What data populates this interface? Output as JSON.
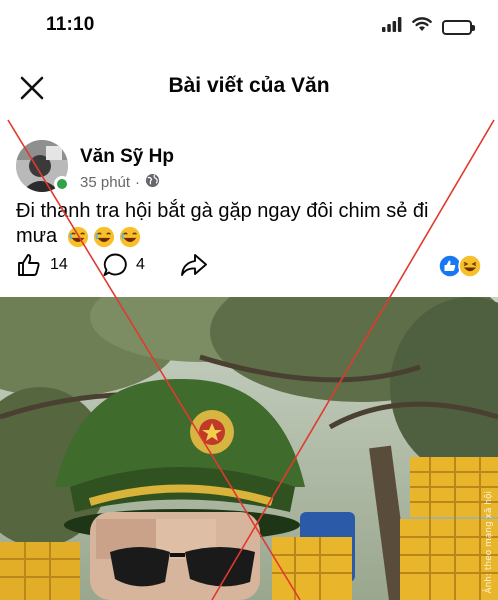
{
  "status_bar": {
    "time": "11:10",
    "icons": [
      "signal-icon",
      "wifi-icon",
      "battery-icon"
    ]
  },
  "nav": {
    "title": "Bài viết của Văn",
    "close_icon": "close-icon"
  },
  "post": {
    "author": "Văn Sỹ Hp",
    "time_ago": "35 phút",
    "separator": "·",
    "privacy_icon": "globe-icon",
    "text": "Đi thanh tra hội bắt gà gặp ngay đôi chim sẻ đi mưa",
    "emojis": [
      "laughing-emoji",
      "laughing-emoji",
      "laughing-emoji"
    ],
    "likes_count": "14",
    "comments_count": "4",
    "reactions": [
      "like-reaction",
      "haha-reaction"
    ]
  },
  "photo": {
    "watermark": "Ảnh: theo mạng xã hội"
  },
  "colors": {
    "online": "#31a24c",
    "like_blue": "#1877f2",
    "cross_red": "#e03a2f",
    "meta_gray": "#65676b"
  }
}
